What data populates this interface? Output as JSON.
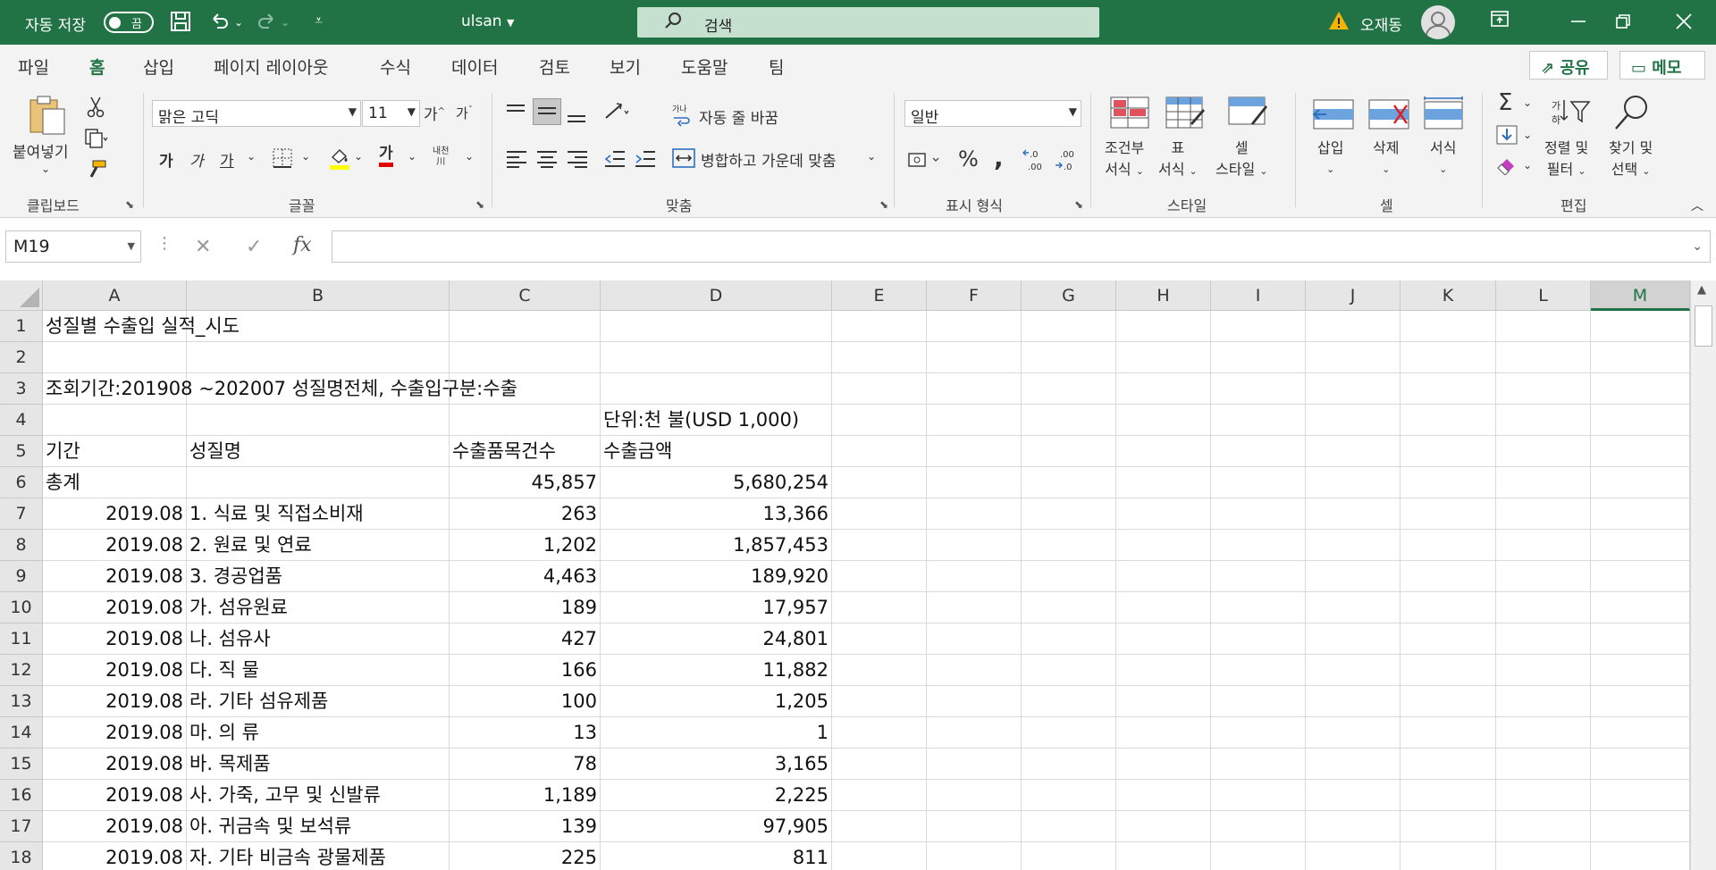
{
  "titlebar": {
    "autosave_label": "자동 저장",
    "toggle_state": "끔",
    "filename": "ulsan",
    "search_placeholder": "검색",
    "user_name": "오재동"
  },
  "tabs": [
    "파일",
    "홈",
    "삽입",
    "페이지 레이아웃",
    "수식",
    "데이터",
    "검토",
    "보기",
    "도움말",
    "팀"
  ],
  "active_tab": "홈",
  "share_label": "공유",
  "memo_label": "메모",
  "ribbon": {
    "clipboard": {
      "paste_label": "붙여넣기",
      "group_label": "클립보드"
    },
    "font": {
      "font_name": "맑은 고딕",
      "font_size": "11",
      "bold": "가",
      "italic": "가",
      "underline": "가",
      "font_color_glyph": "가",
      "phonetic_top": "내천",
      "phonetic_bottom": "川",
      "group_label": "글꼴"
    },
    "alignment": {
      "wrap_label": "자동 줄 바꿈",
      "merge_label": "병합하고 가운데 맞춤",
      "group_label": "맞춤"
    },
    "number": {
      "format": "일반",
      "group_label": "표시 형식"
    },
    "styles": {
      "conditional": [
        "조건부",
        "서식"
      ],
      "table": [
        "표",
        "서식"
      ],
      "cell": [
        "셀",
        "스타일"
      ],
      "group_label": "스타일"
    },
    "cells": {
      "insert": "삽입",
      "delete": "삭제",
      "format": "서식",
      "group_label": "셀"
    },
    "editing": {
      "sort": [
        "정렬 및",
        "필터"
      ],
      "find": [
        "찾기 및",
        "선택"
      ],
      "group_label": "편집"
    }
  },
  "formula_bar": {
    "name_box": "M19",
    "formula": ""
  },
  "grid": {
    "columns": [
      "A",
      "B",
      "C",
      "D",
      "E",
      "F",
      "G",
      "H",
      "I",
      "J",
      "K",
      "L",
      "M"
    ],
    "selected_column": "M",
    "rows": [
      {
        "n": "1",
        "a": "성질별 수출입 실적_시도",
        "b": "",
        "c": "",
        "d": ""
      },
      {
        "n": "2",
        "a": "",
        "b": "",
        "c": "",
        "d": ""
      },
      {
        "n": "3",
        "a": "조회기간:201908 ~202007 성질명전체, 수출입구분:수출",
        "b": "",
        "c": "",
        "d": ""
      },
      {
        "n": "4",
        "a": "",
        "b": "",
        "c": "",
        "d": "단위:천 불(USD 1,000)"
      },
      {
        "n": "5",
        "a": "기간",
        "b": "성질명",
        "c": "수출품목건수",
        "d": "수출금액"
      },
      {
        "n": "6",
        "a": "총계",
        "b": "",
        "c": "45,857",
        "d": "5,680,254"
      },
      {
        "n": "7",
        "a": "2019.08",
        "b": "1. 식료 및 직접소비재",
        "c": "263",
        "d": "13,366"
      },
      {
        "n": "8",
        "a": "2019.08",
        "b": "2. 원료 및 연료",
        "c": "1,202",
        "d": "1,857,453"
      },
      {
        "n": "9",
        "a": "2019.08",
        "b": "3. 경공업품",
        "c": "4,463",
        "d": "189,920"
      },
      {
        "n": "10",
        "a": "2019.08",
        "b": "가. 섬유원료",
        "c": "189",
        "d": "17,957"
      },
      {
        "n": "11",
        "a": "2019.08",
        "b": "나. 섬유사",
        "c": "427",
        "d": "24,801"
      },
      {
        "n": "12",
        "a": "2019.08",
        "b": "다. 직 물",
        "c": "166",
        "d": "11,882"
      },
      {
        "n": "13",
        "a": "2019.08",
        "b": "라. 기타 섬유제품",
        "c": "100",
        "d": "1,205"
      },
      {
        "n": "14",
        "a": "2019.08",
        "b": "마. 의 류",
        "c": "13",
        "d": "1"
      },
      {
        "n": "15",
        "a": "2019.08",
        "b": "바. 목제품",
        "c": "78",
        "d": "3,165"
      },
      {
        "n": "16",
        "a": "2019.08",
        "b": "사. 가죽, 고무 및 신발류",
        "c": "1,189",
        "d": "2,225"
      },
      {
        "n": "17",
        "a": "2019.08",
        "b": "아. 귀금속 및 보석류",
        "c": "139",
        "d": "97,905"
      },
      {
        "n": "18",
        "a": "2019.08",
        "b": "자. 기타 비금속 광물제품",
        "c": "225",
        "d": "811"
      }
    ]
  },
  "colors": {
    "accent": "#217346",
    "search_bg": "#c5e0cf",
    "ribbon_bg": "#f3f3f3"
  }
}
